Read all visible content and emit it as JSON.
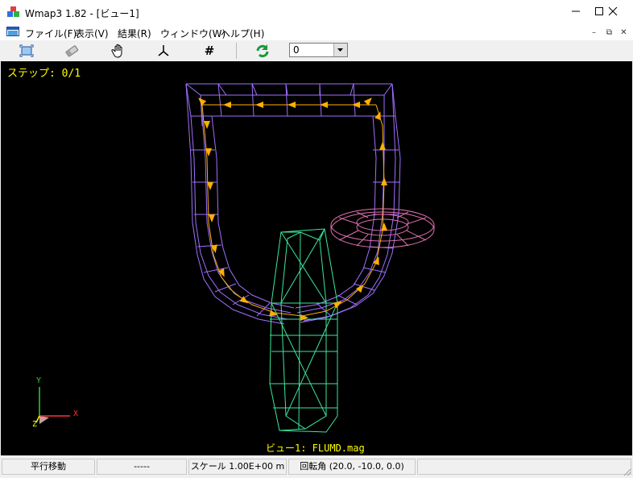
{
  "window": {
    "title": "Wmap3 1.82 - [ビュー1]",
    "min": "—",
    "max": "☐",
    "close": "✕"
  },
  "menu": {
    "items": [
      "ファイル(F)",
      "表示(V)",
      "結果(R)",
      "ウィンドウ(W)",
      "ヘルプ(H)"
    ],
    "mdi": {
      "min": "–",
      "restore": "⧉",
      "close": "✕"
    }
  },
  "toolbar": {
    "combo_value": "0",
    "grid_glyph": "#"
  },
  "view": {
    "step_label": "ステップ: 0/1",
    "view_label": "ビュー1: FLUMD.mag",
    "axis_x": "X",
    "axis_y": "Y",
    "axis_z": "Z"
  },
  "status": {
    "mode": "平行移動",
    "blank": "-----",
    "scale": "スケール 1.00E+00 m",
    "rotation": "回転角 (20.0, -10.0, 0.0)"
  },
  "colors": {
    "background": "#000000",
    "wire_purple": "#a070ff",
    "wire_green": "#3ce89c",
    "wire_pink": "#e070b0",
    "arrows": "#ffb000",
    "label": "#ffff00",
    "axis_x": "#ff3030",
    "axis_y": "#30d030",
    "axis_z": "#ffff00"
  },
  "icons": [
    "fit-view-icon",
    "eraser-icon",
    "pan-hand-icon",
    "axes-icon",
    "grid-icon",
    "refresh-arrow-icon"
  ]
}
